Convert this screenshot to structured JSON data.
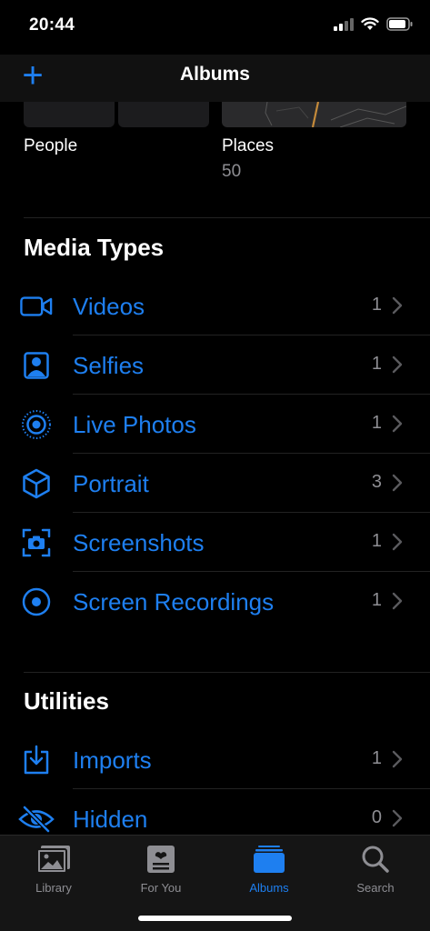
{
  "status": {
    "time": "20:44"
  },
  "nav": {
    "title": "Albums",
    "add_label": "+"
  },
  "people_places": [
    {
      "name": "People",
      "count": ""
    },
    {
      "name": "Places",
      "count": "50"
    }
  ],
  "media_types": {
    "title": "Media Types",
    "items": [
      {
        "label": "Videos",
        "count": "1",
        "icon": "video-icon"
      },
      {
        "label": "Selfies",
        "count": "1",
        "icon": "selfie-icon"
      },
      {
        "label": "Live Photos",
        "count": "1",
        "icon": "live-photo-icon"
      },
      {
        "label": "Portrait",
        "count": "3",
        "icon": "portrait-cube-icon"
      },
      {
        "label": "Screenshots",
        "count": "1",
        "icon": "screenshot-icon"
      },
      {
        "label": "Screen Recordings",
        "count": "1",
        "icon": "screen-recording-icon"
      }
    ]
  },
  "utilities": {
    "title": "Utilities",
    "items": [
      {
        "label": "Imports",
        "count": "1",
        "icon": "import-icon"
      },
      {
        "label": "Hidden",
        "count": "0",
        "icon": "hidden-eye-icon"
      }
    ]
  },
  "tabs": [
    {
      "label": "Library",
      "icon": "library-photos-icon",
      "active": false
    },
    {
      "label": "For You",
      "icon": "for-you-icon",
      "active": false
    },
    {
      "label": "Albums",
      "icon": "albums-icon",
      "active": true
    },
    {
      "label": "Search",
      "icon": "search-icon",
      "active": false
    }
  ],
  "colors": {
    "accent": "#1e7ff0",
    "secondary_text": "#8e8e93",
    "background": "#000000"
  }
}
